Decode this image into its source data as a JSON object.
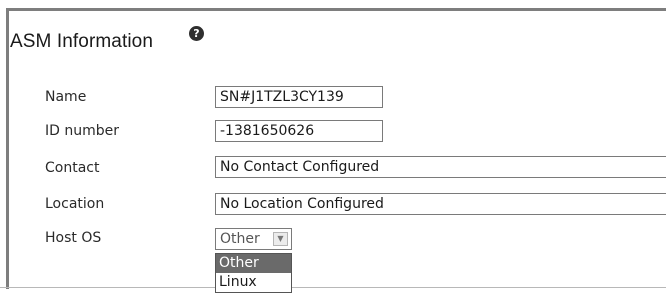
{
  "section": {
    "title": "ASM Information",
    "help_icon": "help-icon",
    "help_glyph": "?"
  },
  "fields": {
    "name": {
      "label": "Name",
      "value": "SN#J1TZL3CY139"
    },
    "id_number": {
      "label": "ID number",
      "value": "-1381650626"
    },
    "contact": {
      "label": "Contact",
      "value": "No Contact Configured"
    },
    "location": {
      "label": "Location",
      "value": "No Location Configured"
    },
    "host_os": {
      "label": "Host OS",
      "selected": "Other",
      "options": [
        "Other",
        "Linux"
      ],
      "highlighted_option": "Other"
    }
  },
  "colors": {
    "border": "#7e7e7e",
    "selected_option_bg": "#6a6a6a"
  }
}
